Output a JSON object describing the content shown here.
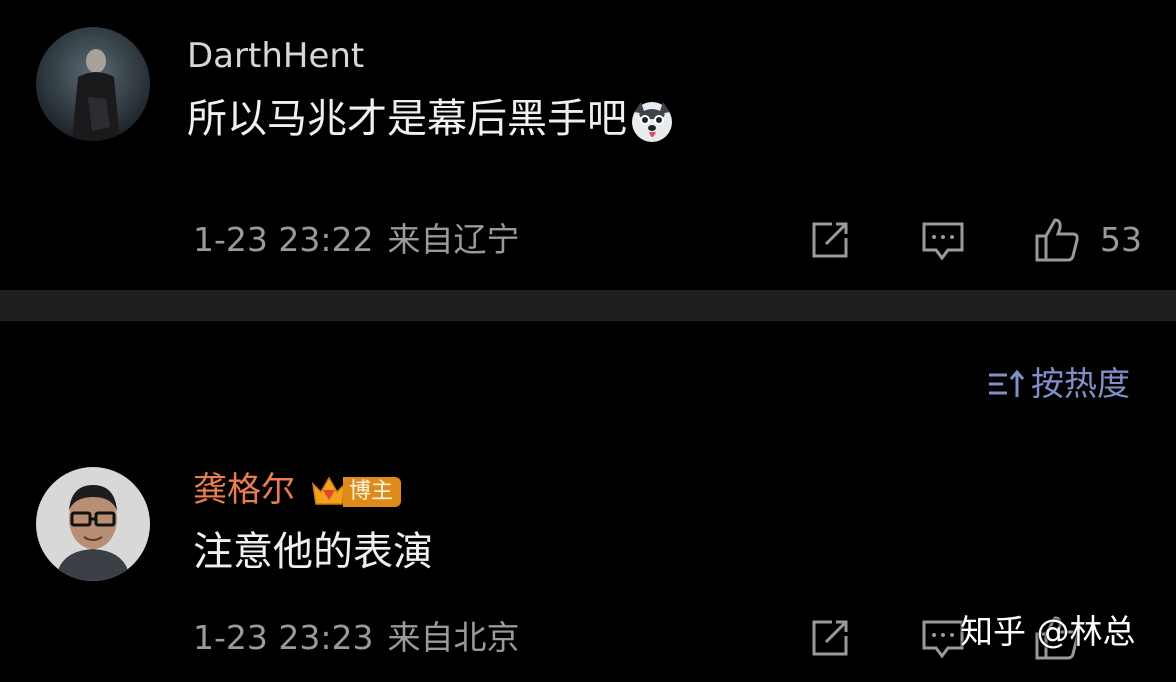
{
  "comments": [
    {
      "author": "DarthHent",
      "text": "所以马兆才是幕后黑手吧",
      "emoji": "husky-dog-emoji",
      "time": "1-23 23:22",
      "location": "来自辽宁",
      "likes": "53"
    },
    {
      "author": "龚格尔",
      "badge": "博主",
      "text": "注意他的表演",
      "time": "1-23 23:23",
      "location": "来自北京"
    }
  ],
  "sort": {
    "label": "按热度",
    "icon": "sort-icon"
  },
  "watermark": "知乎 @林总",
  "colors": {
    "background": "#000000",
    "divider": "#1f1f1f",
    "author_highlight": "#ee7d4c",
    "sort_accent": "#7f90c9",
    "meta": "#9a9a9a"
  }
}
